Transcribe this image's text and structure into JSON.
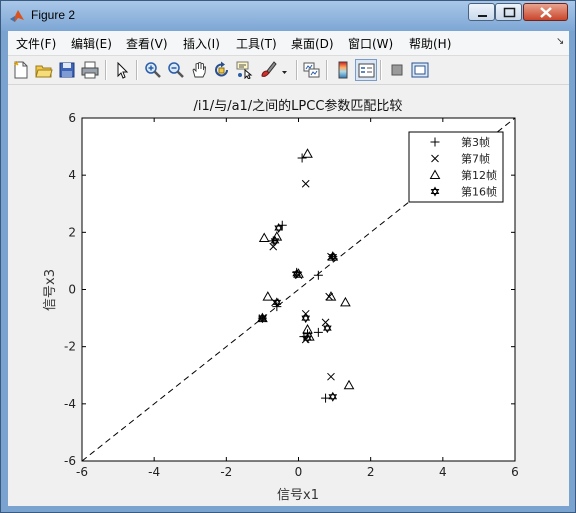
{
  "window": {
    "title": "Figure 2"
  },
  "menu": {
    "items": [
      "文件(F)",
      "编辑(E)",
      "查看(V)",
      "插入(I)",
      "工具(T)",
      "桌面(D)",
      "窗口(W)",
      "帮助(H)"
    ],
    "overflow_icon": "dock-arrow-icon"
  },
  "toolbar": {
    "icons": [
      "new-figure-icon",
      "open-file-icon",
      "save-icon",
      "print-icon",
      "edit-plot-arrow-icon",
      "zoom-in-icon",
      "zoom-out-icon",
      "pan-hand-icon",
      "rotate-3d-icon",
      "data-cursor-icon",
      "brush-icon",
      "brush-dropdown-icon",
      "link-plot-icon",
      "insert-colorbar-icon",
      "insert-legend-icon",
      "hide-plot-tools-icon",
      "show-plot-tools-icon"
    ]
  },
  "chart_data": {
    "type": "scatter",
    "title": "/i1/与/a1/之间的LPCC参数匹配比较",
    "xlabel": "信号x1",
    "ylabel": "信号x3",
    "xlim": [
      -6,
      6
    ],
    "ylim": [
      -6,
      6
    ],
    "xticks": [
      -6,
      -4,
      -2,
      0,
      2,
      4,
      6
    ],
    "yticks": [
      -6,
      -4,
      -2,
      0,
      2,
      4,
      6
    ],
    "grid": false,
    "legend_position": "top-right",
    "reference_line": {
      "style": "dashed",
      "from": [
        -6,
        -6
      ],
      "to": [
        6,
        6
      ]
    },
    "series": [
      {
        "name": "第3帧",
        "marker": "plus",
        "points": [
          [
            0.1,
            4.6
          ],
          [
            -0.45,
            2.25
          ],
          [
            -0.7,
            1.7
          ],
          [
            0.95,
            1.15
          ],
          [
            0.55,
            0.5
          ],
          [
            -0.05,
            0.6
          ],
          [
            -1.0,
            -1.0
          ],
          [
            -0.6,
            -0.6
          ],
          [
            0.15,
            -1.65
          ],
          [
            0.25,
            -1.55
          ],
          [
            0.55,
            -1.5
          ],
          [
            0.75,
            -3.8
          ]
        ]
      },
      {
        "name": "第7帧",
        "marker": "x",
        "points": [
          [
            0.2,
            3.7
          ],
          [
            -0.7,
            1.5
          ],
          [
            0.9,
            1.15
          ],
          [
            0.0,
            0.5
          ],
          [
            0.85,
            -0.25
          ],
          [
            -0.65,
            -0.45
          ],
          [
            0.2,
            -0.85
          ],
          [
            -1.0,
            -1.0
          ],
          [
            0.75,
            -1.15
          ],
          [
            0.9,
            -3.05
          ],
          [
            0.2,
            -1.75
          ]
        ]
      },
      {
        "name": "第12帧",
        "marker": "triangle",
        "points": [
          [
            0.25,
            4.75
          ],
          [
            -0.95,
            1.8
          ],
          [
            -0.6,
            1.85
          ],
          [
            0.95,
            1.15
          ],
          [
            0.0,
            0.55
          ],
          [
            -0.85,
            -0.25
          ],
          [
            0.9,
            -0.25
          ],
          [
            1.3,
            -0.45
          ],
          [
            0.25,
            -1.4
          ],
          [
            0.3,
            -1.65
          ],
          [
            1.4,
            -3.35
          ],
          [
            -1.0,
            -1.0
          ]
        ]
      },
      {
        "name": "第16帧",
        "marker": "hexagram",
        "points": [
          [
            -0.55,
            2.15
          ],
          [
            -0.65,
            1.7
          ],
          [
            0.95,
            1.15
          ],
          [
            -0.05,
            0.55
          ],
          [
            -0.6,
            -0.45
          ],
          [
            0.2,
            -1.0
          ],
          [
            0.8,
            -1.35
          ],
          [
            -1.0,
            -1.0
          ],
          [
            0.25,
            -1.7
          ],
          [
            0.95,
            -3.75
          ]
        ]
      }
    ]
  }
}
